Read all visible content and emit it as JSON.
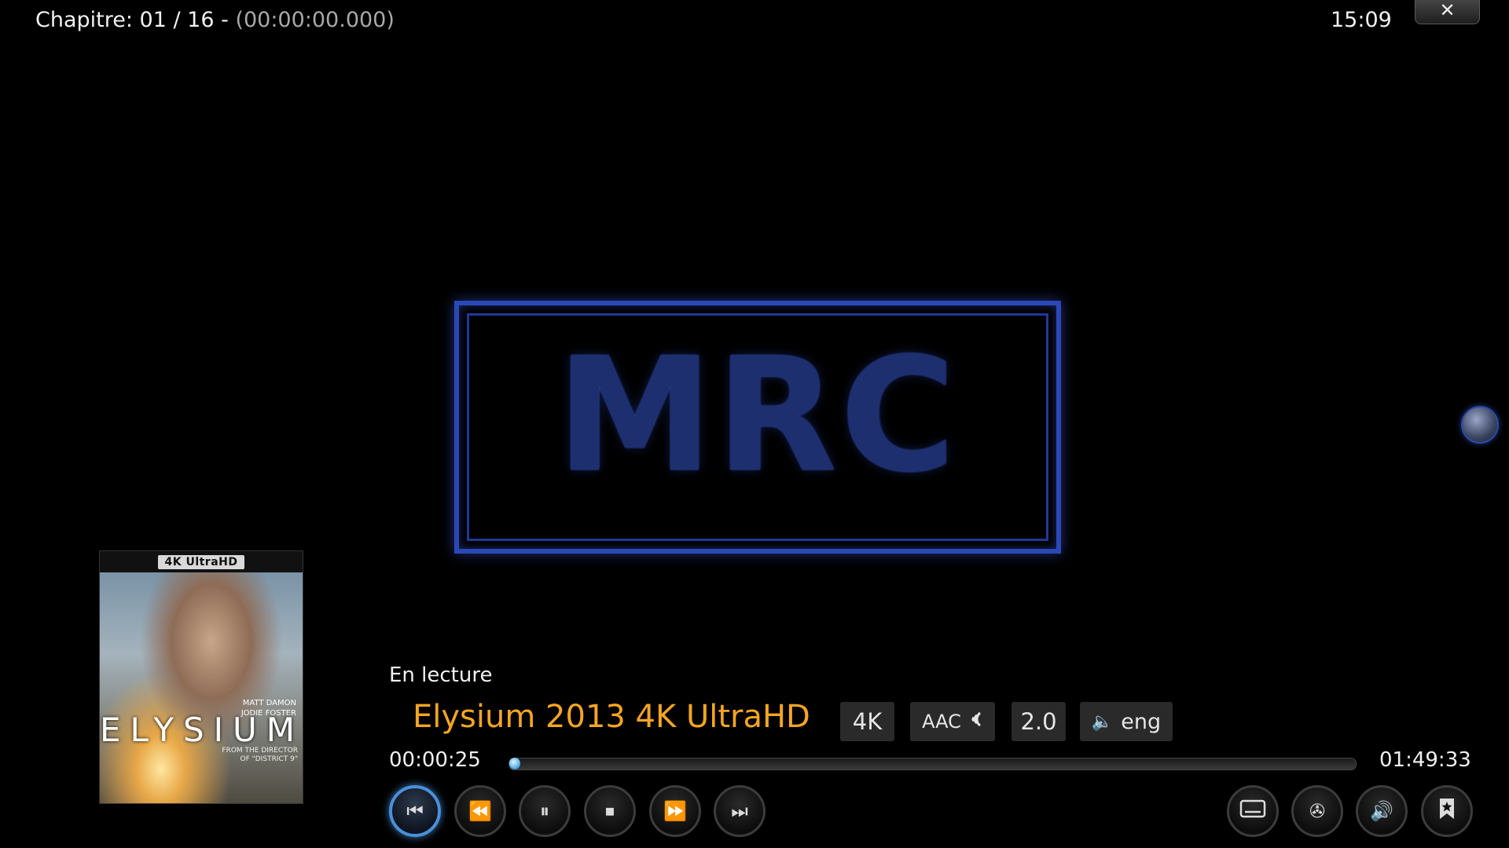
{
  "top_bar": {
    "chapter_text": "Chapitre: 01 / 16 -",
    "chapter_timestamp": "(00:00:00.000)",
    "clock": "15:09",
    "close_glyph": "✕"
  },
  "video": {
    "logo_text": "MRC"
  },
  "poster": {
    "badge": "4K UltraHD",
    "credits_line1": "MATT DAMON",
    "credits_line2": "JODIE FOSTER",
    "title": "ELYSIUM",
    "tagline_line1": "FROM THE DIRECTOR",
    "tagline_line2": "OF \"DISTRICT 9\""
  },
  "now_playing": {
    "label": "En lecture",
    "title": "Elysium 2013 4K UltraHD",
    "tags": {
      "resolution": "4K",
      "codec": "AAC",
      "channels": "2.0",
      "language": "eng"
    }
  },
  "progress": {
    "elapsed": "00:00:25",
    "total": "01:49:33",
    "fraction": 0.004
  },
  "controls": {
    "icons": {
      "previous": "⏮",
      "rewind": "⏪",
      "pause": "⏸",
      "stop": "⏹",
      "forward": "⏩",
      "next": "⏭",
      "subtitles": "▭",
      "video": "✇",
      "audio": "🔊",
      "bookmark": "★",
      "speaker": "🔈"
    }
  },
  "colors": {
    "accent_title": "#f5a623",
    "focus_ring": "#4a90d9",
    "logo_blue": "#2b48b8"
  }
}
